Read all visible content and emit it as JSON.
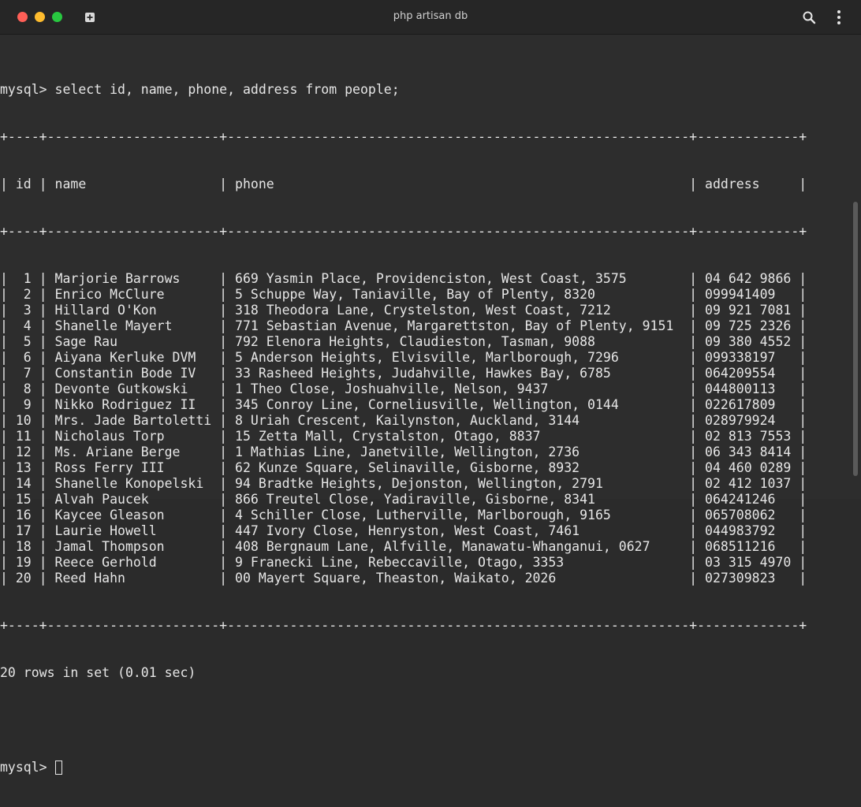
{
  "window": {
    "title": "php artisan db"
  },
  "icons": {
    "close": "close-icon",
    "minimize": "minimize-icon",
    "zoom": "zoom-icon",
    "new_tab": "new-tab-icon",
    "search": "search-icon",
    "menu": "kebab-menu-icon"
  },
  "colors": {
    "close": "#ff5f57",
    "minimize": "#febc2e",
    "zoom": "#28c840",
    "background": "#2d2d2d",
    "text": "#e6e6e6"
  },
  "terminal": {
    "command_line": "mysql> select id, name, phone, address from people;",
    "border": "+----+----------------------+-----------------------------------------------------------+-------------+",
    "header": "| id | name                 | phone                                                     | address     |",
    "rows": [
      "|  1 | Marjorie Barrows     | 669 Yasmin Place, Providenciston, West Coast, 3575        | 04 642 9866 |",
      "|  2 | Enrico McClure       | 5 Schuppe Way, Taniaville, Bay of Plenty, 8320            | 099941409   |",
      "|  3 | Hillard O'Kon        | 318 Theodora Lane, Crystelston, West Coast, 7212          | 09 921 7081 |",
      "|  4 | Shanelle Mayert      | 771 Sebastian Avenue, Margarettston, Bay of Plenty, 9151  | 09 725 2326 |",
      "|  5 | Sage Rau             | 792 Elenora Heights, Claudieston, Tasman, 9088            | 09 380 4552 |",
      "|  6 | Aiyana Kerluke DVM   | 5 Anderson Heights, Elvisville, Marlborough, 7296         | 099338197   |",
      "|  7 | Constantin Bode IV   | 33 Rasheed Heights, Judahville, Hawkes Bay, 6785          | 064209554   |",
      "|  8 | Devonte Gutkowski    | 1 Theo Close, Joshuahville, Nelson, 9437                  | 044800113   |",
      "|  9 | Nikko Rodriguez II   | 345 Conroy Line, Corneliusville, Wellington, 0144         | 022617809   |",
      "| 10 | Mrs. Jade Bartoletti | 8 Uriah Crescent, Kailynston, Auckland, 3144              | 028979924   |",
      "| 11 | Nicholaus Torp       | 15 Zetta Mall, Crystalston, Otago, 8837                   | 02 813 7553 |",
      "| 12 | Ms. Ariane Berge     | 1 Mathias Line, Janetville, Wellington, 2736              | 06 343 8414 |",
      "| 13 | Ross Ferry III       | 62 Kunze Square, Selinaville, Gisborne, 8932              | 04 460 0289 |",
      "| 14 | Shanelle Konopelski  | 94 Bradtke Heights, Dejonston, Wellington, 2791           | 02 412 1037 |",
      "| 15 | Alvah Paucek         | 866 Treutel Close, Yadiraville, Gisborne, 8341            | 064241246   |",
      "| 16 | Kaycee Gleason       | 4 Schiller Close, Lutherville, Marlborough, 9165          | 065708062   |",
      "| 17 | Laurie Howell        | 447 Ivory Close, Henryston, West Coast, 7461              | 044983792   |",
      "| 18 | Jamal Thompson       | 408 Bergnaum Lane, Alfville, Manawatu-Whanganui, 0627     | 068511216   |",
      "| 19 | Reece Gerhold        | 9 Franecki Line, Rebeccaville, Otago, 3353                | 03 315 4970 |",
      "| 20 | Reed Hahn            | 00 Mayert Square, Theaston, Waikato, 2026                 | 027309823   |"
    ],
    "summary": "20 rows in set (0.01 sec)",
    "prompt": "mysql> "
  }
}
